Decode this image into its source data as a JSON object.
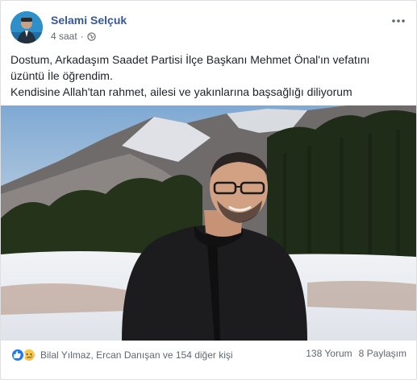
{
  "post": {
    "author": "Selami Selçuk",
    "time": "4 saat",
    "separator": "·",
    "text_lines": [
      "Dostum, Arkadaşım Saadet Partisi İlçe Başkanı Mehmet Önal'ın vefatını",
      "üzüntü İle öğrendim.",
      "Kendisine Allah'tan rahmet, ailesi ve yakınlarına başsağlığı diliyorum"
    ]
  },
  "footer": {
    "reactions_text": "Bilal Yılmaz, Ercan Danışan ve 154 diğer kişi",
    "comments": "138 Yorum",
    "shares": "8 Paylaşım"
  },
  "icons": {
    "more": "more-horizontal-icon",
    "privacy": "globe-icon",
    "reaction_1": "like-icon",
    "reaction_2": "sad-icon"
  },
  "colors": {
    "author": "#365899",
    "text": "#1d2129",
    "secondary": "#616770",
    "like": "#2078f4",
    "sad": "#f7c64a"
  }
}
